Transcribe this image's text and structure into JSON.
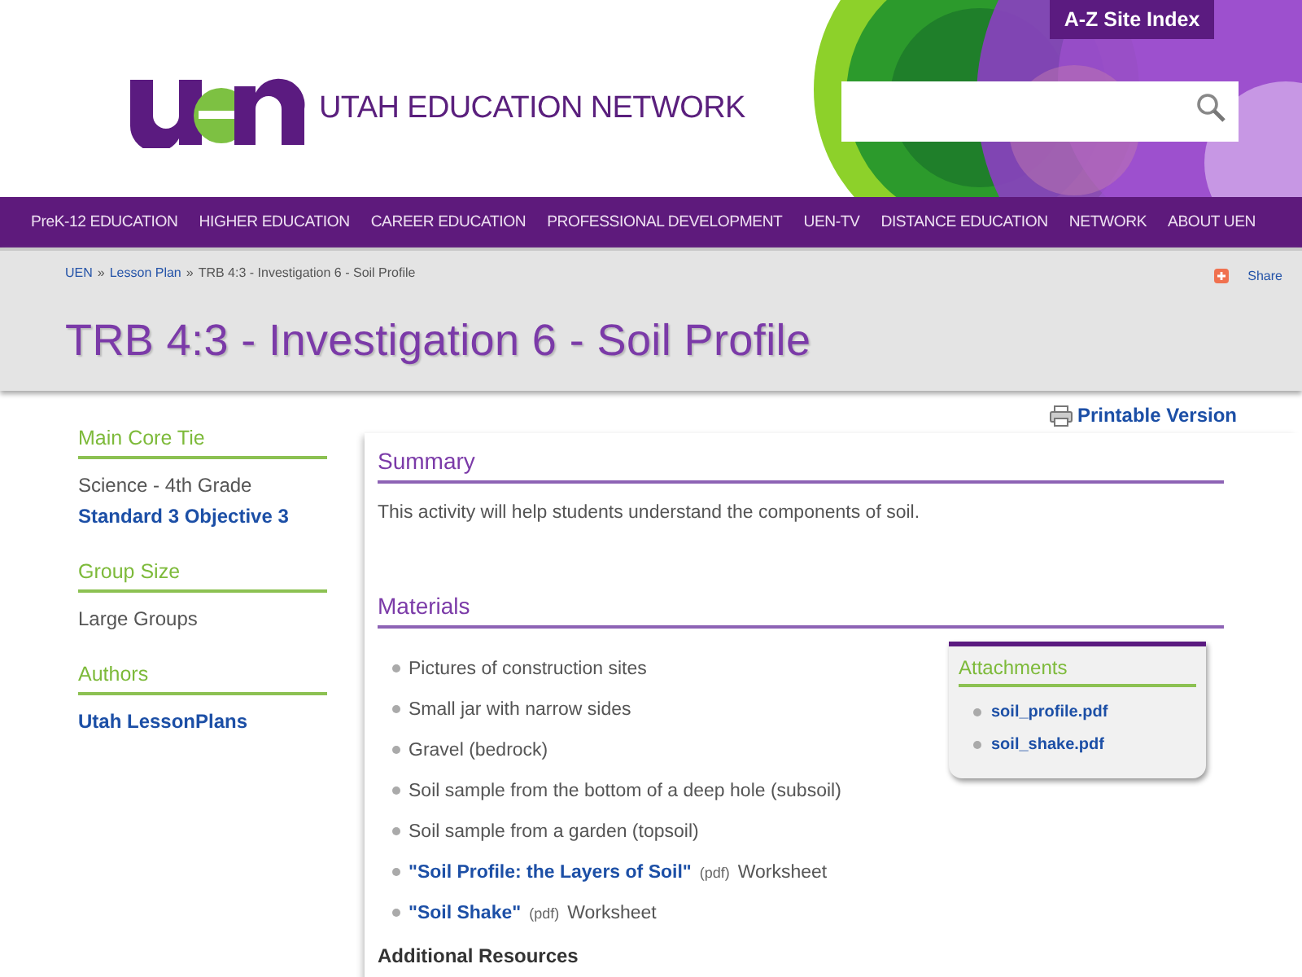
{
  "header": {
    "logo_text": "UTAH EDUCATION NETWORK",
    "site_index": "A-Z Site Index"
  },
  "nav": [
    "PreK-12 EDUCATION",
    "HIGHER EDUCATION",
    "CAREER EDUCATION",
    "PROFESSIONAL DEVELOPMENT",
    "UEN-TV",
    "DISTANCE EDUCATION",
    "NETWORK",
    "ABOUT UEN"
  ],
  "breadcrumb": {
    "links": [
      "UEN",
      "Lesson Plan"
    ],
    "current": "TRB 4:3 - Investigation 6 - Soil Profile",
    "separator": "»"
  },
  "share": "Share",
  "title": "TRB 4:3 - Investigation 6 - Soil Profile",
  "printable": "Printable Version",
  "sidebar": [
    {
      "heading": "Main Core Tie",
      "items": [
        {
          "kind": "text",
          "text": "Science - 4th Grade"
        },
        {
          "kind": "link",
          "text": "Standard 3 Objective 3"
        }
      ]
    },
    {
      "heading": "Group Size",
      "items": [
        {
          "kind": "text",
          "text": "Large Groups"
        }
      ]
    },
    {
      "heading": "Authors",
      "items": [
        {
          "kind": "link",
          "text": "Utah LessonPlans"
        }
      ]
    }
  ],
  "summary": {
    "heading": "Summary",
    "text": "This activity will help students understand the components of soil."
  },
  "materials": {
    "heading": "Materials",
    "items": [
      {
        "kind": "text",
        "text": "Pictures of construction sites"
      },
      {
        "kind": "text",
        "text": "Small jar with narrow sides"
      },
      {
        "kind": "text",
        "text": "Gravel (bedrock)"
      },
      {
        "kind": "text",
        "text": "Soil sample from the bottom of a deep hole (subsoil)"
      },
      {
        "kind": "text",
        "text": "Soil sample from a garden (topsoil)"
      },
      {
        "kind": "link",
        "text": "\"Soil Profile: the Layers of Soil\"",
        "note": "(pdf)",
        "suffix": "Worksheet"
      },
      {
        "kind": "link",
        "text": "\"Soil Shake\"",
        "note": "(pdf)",
        "suffix": "Worksheet"
      }
    ]
  },
  "attachments": {
    "heading": "Attachments",
    "files": [
      "soil_profile.pdf",
      "soil_shake.pdf"
    ]
  },
  "additional_resources": "Additional Resources"
}
